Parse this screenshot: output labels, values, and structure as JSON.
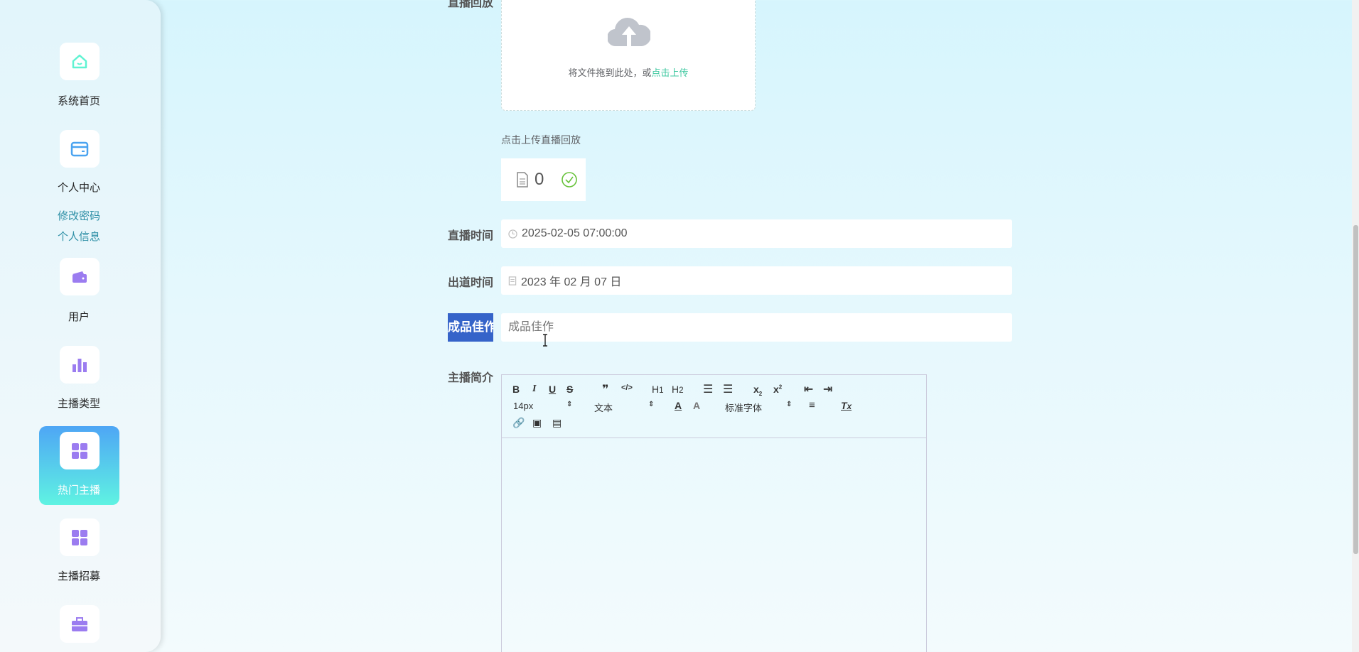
{
  "sidebar": {
    "items": [
      {
        "label": "系统首页",
        "icon": "home-icon"
      },
      {
        "label": "个人中心",
        "icon": "card-icon",
        "sub": [
          "修改密码",
          "个人信息"
        ]
      },
      {
        "label": "用户",
        "icon": "wallet-icon"
      },
      {
        "label": "主播类型",
        "icon": "bar-chart-icon"
      },
      {
        "label": "热门主播",
        "icon": "grid-icon",
        "active": true
      },
      {
        "label": "主播招募",
        "icon": "grid-icon"
      },
      {
        "label": "",
        "icon": "briefcase-icon"
      }
    ]
  },
  "form": {
    "replay": {
      "label": "直播回放",
      "drop_text": "将文件拖到此处，或",
      "drop_link": "点击上传",
      "hint": "点击上传直播回放",
      "file_name": "0"
    },
    "live_time": {
      "label": "直播时间",
      "value": "2025-02-05 07:00:00"
    },
    "debut_time": {
      "label": "出道时间",
      "value": "2023 年 02 月 07 日"
    },
    "works": {
      "label": "成品佳作",
      "placeholder": "成品佳作"
    },
    "intro": {
      "label": "主播简介",
      "toolbar": {
        "size": "14px",
        "header": "文本",
        "font": "标准字体"
      }
    }
  },
  "colors": {
    "accent": "#3ec8a0",
    "active_gradient_top": "#4ea6f5",
    "active_gradient_bottom": "#5ff3e2",
    "icon_purple": "#9b7cf0",
    "selection": "#3563c9"
  }
}
